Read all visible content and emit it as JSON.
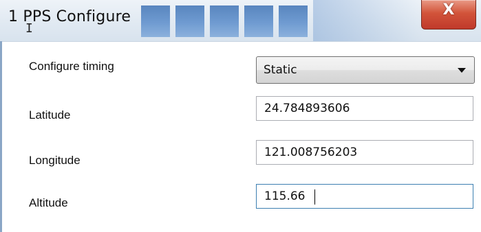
{
  "window": {
    "title": "1 PPS Configure",
    "cursor_glyph": "I",
    "close_glyph": "X",
    "close_button_color": "#c0392b"
  },
  "form": {
    "configure_timing": {
      "label": "Configure timing",
      "value": "Static"
    },
    "latitude": {
      "label": "Latitude",
      "value": "24.784893606"
    },
    "longitude": {
      "label": "Longitude",
      "value": "121.008756203"
    },
    "altitude": {
      "label": "Altitude",
      "value": "115.66"
    }
  }
}
